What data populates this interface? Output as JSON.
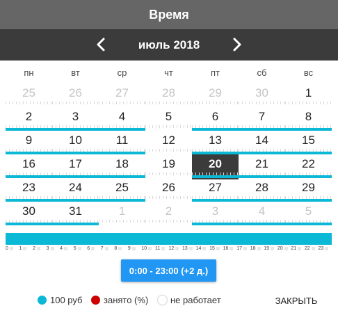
{
  "title": "Время",
  "month_label": "июль 2018",
  "weekdays": [
    "пн",
    "вт",
    "ср",
    "чт",
    "пт",
    "сб",
    "вс"
  ],
  "weeks": [
    [
      {
        "day": "25",
        "other": true
      },
      {
        "day": "26",
        "other": true
      },
      {
        "day": "27",
        "other": true
      },
      {
        "day": "28",
        "other": true
      },
      {
        "day": "29",
        "other": true
      },
      {
        "day": "30",
        "other": true
      },
      {
        "day": "1"
      }
    ],
    [
      {
        "day": "2",
        "bar": true
      },
      {
        "day": "3",
        "bar": true
      },
      {
        "day": "4",
        "bar": true
      },
      {
        "day": "5"
      },
      {
        "day": "6",
        "bar": true
      },
      {
        "day": "7",
        "bar": true
      },
      {
        "day": "8",
        "bar": true
      }
    ],
    [
      {
        "day": "9",
        "bar": true
      },
      {
        "day": "10",
        "bar": true
      },
      {
        "day": "11",
        "bar": true
      },
      {
        "day": "12"
      },
      {
        "day": "13",
        "bar": true
      },
      {
        "day": "14",
        "bar": true
      },
      {
        "day": "15",
        "bar": true
      }
    ],
    [
      {
        "day": "16",
        "bar": true
      },
      {
        "day": "17",
        "bar": true
      },
      {
        "day": "18",
        "bar": true
      },
      {
        "day": "19"
      },
      {
        "day": "20",
        "bar": true,
        "selected": true
      },
      {
        "day": "21",
        "bar": true
      },
      {
        "day": "22",
        "bar": true
      }
    ],
    [
      {
        "day": "23",
        "bar": true
      },
      {
        "day": "24",
        "bar": true
      },
      {
        "day": "25",
        "bar": true
      },
      {
        "day": "26"
      },
      {
        "day": "27",
        "bar": true
      },
      {
        "day": "28",
        "bar": true
      },
      {
        "day": "29",
        "bar": true
      }
    ],
    [
      {
        "day": "30",
        "bar": true
      },
      {
        "day": "31",
        "bar": true
      },
      {
        "day": "1",
        "other": true
      },
      {
        "day": "2",
        "other": true
      },
      {
        "day": "3",
        "other": true,
        "bar": true
      },
      {
        "day": "4",
        "other": true,
        "bar": true
      },
      {
        "day": "5",
        "other": true,
        "bar": true
      }
    ]
  ],
  "hours": [
    "0",
    "1",
    "2",
    "3",
    "4",
    "5",
    "6",
    "7",
    "8",
    "9",
    "10",
    "11",
    "12",
    "13",
    "14",
    "15",
    "16",
    "17",
    "18",
    "19",
    "20",
    "21",
    "22",
    "23"
  ],
  "time_button_label": "0:00 - 23:00 (+2 д.)",
  "legend": [
    {
      "label": "100 руб",
      "color": "#0bb8d6",
      "icon": "available-dot-icon"
    },
    {
      "label": "занято (%)",
      "color": "#cc0000",
      "icon": "busy-dot-icon"
    },
    {
      "label": "не работает",
      "color": "#ffffff",
      "icon": "closed-dot-icon"
    }
  ],
  "close_label": "ЗАКРЫТЬ",
  "colors": {
    "accent": "#0bb8d6",
    "button": "#2196f3",
    "header": "#666666",
    "nav": "#3b3b3b"
  }
}
